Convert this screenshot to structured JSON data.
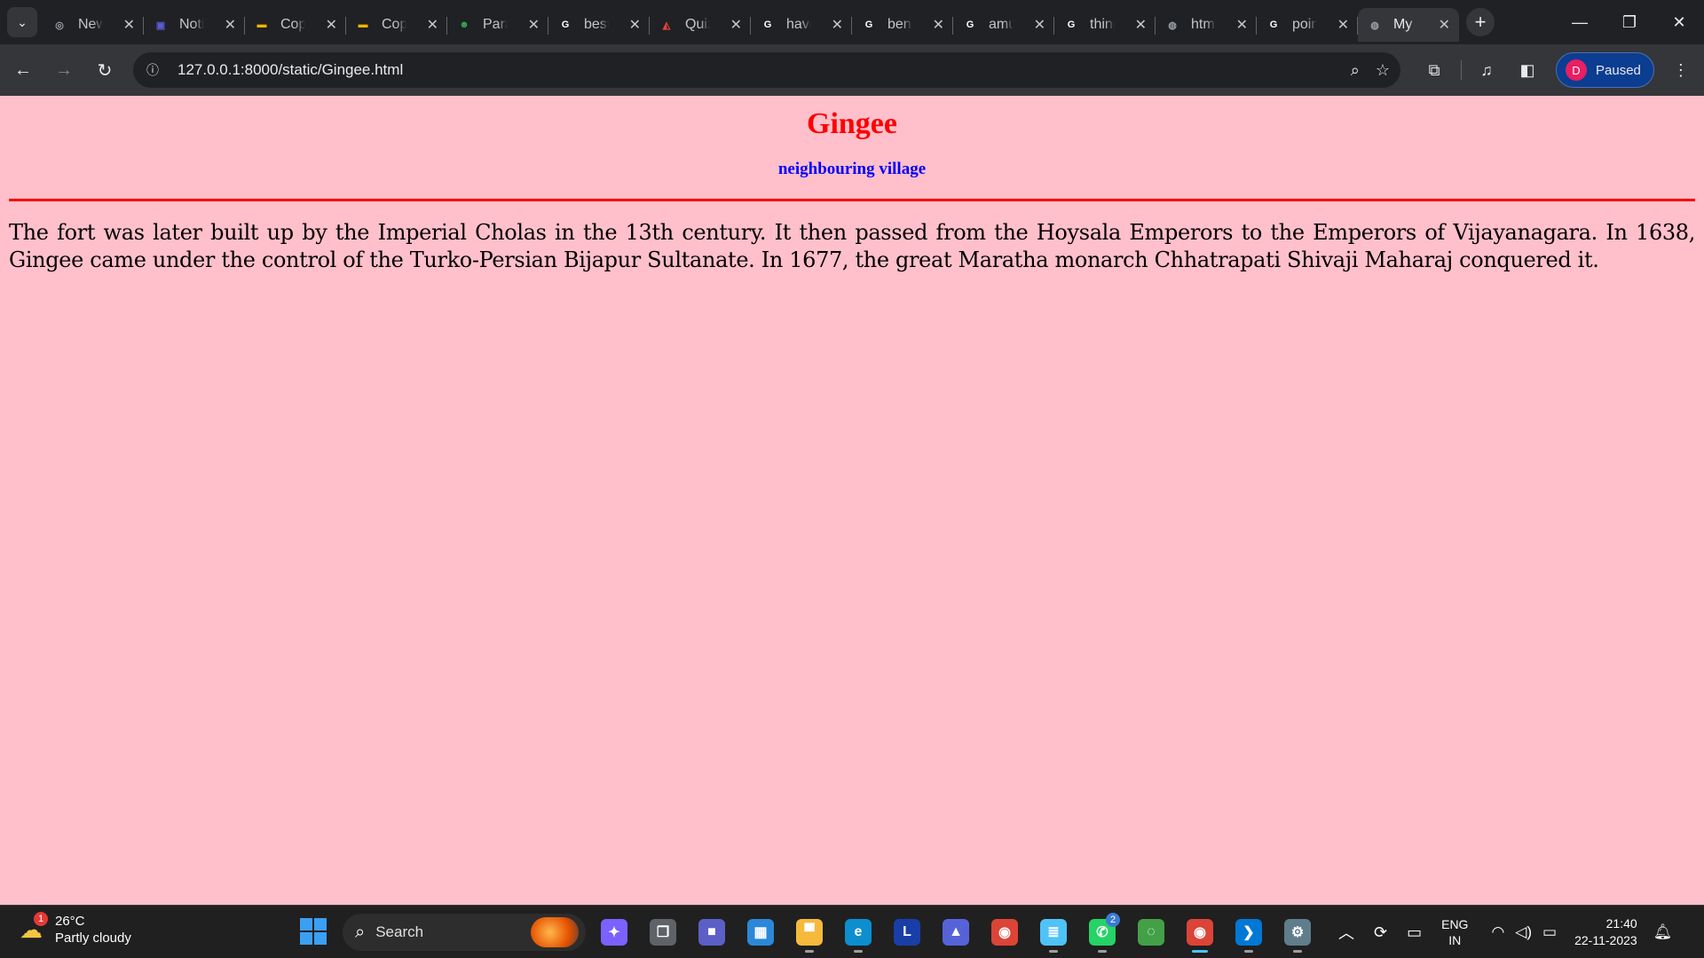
{
  "browser": {
    "tabs": [
      {
        "title": "New Tab",
        "favicon": "chrome-icon",
        "color": "#9aa0a6",
        "glyph": "◎"
      },
      {
        "title": "Notion",
        "favicon": "notion-icon",
        "color": "#5b5bd6",
        "glyph": "▣"
      },
      {
        "title": "Copy of Slides",
        "favicon": "slides-icon",
        "color": "#f4b400",
        "glyph": "▬"
      },
      {
        "title": "Copy of Slides",
        "favicon": "slides-icon",
        "color": "#f4b400",
        "glyph": "▬"
      },
      {
        "title": "Paraphraser",
        "favicon": "robot-icon",
        "color": "#34a853",
        "glyph": "☻"
      },
      {
        "title": "best",
        "favicon": "google-icon",
        "color": "#ffffff",
        "glyph": "G"
      },
      {
        "title": "Quiz",
        "favicon": "quiz-icon",
        "color": "#ea4335",
        "glyph": "◭"
      },
      {
        "title": "have",
        "favicon": "google-icon",
        "color": "#ffffff",
        "glyph": "G"
      },
      {
        "title": "benefits",
        "favicon": "google-icon",
        "color": "#ffffff",
        "glyph": "G"
      },
      {
        "title": "amu",
        "favicon": "google-icon",
        "color": "#ffffff",
        "glyph": "G"
      },
      {
        "title": "things",
        "favicon": "google-icon",
        "color": "#ffffff",
        "glyph": "G"
      },
      {
        "title": "html",
        "favicon": "globe-icon",
        "color": "#9aa0a6",
        "glyph": "◍"
      },
      {
        "title": "points",
        "favicon": "google-icon",
        "color": "#ffffff",
        "glyph": "G"
      },
      {
        "title": "My",
        "favicon": "globe-icon",
        "color": "#9aa0a6",
        "glyph": "◍",
        "active": true
      }
    ],
    "url": "127.0.0.1:8000/static/Gingee.html",
    "profile": {
      "initial": "D",
      "status": "Paused"
    }
  },
  "page": {
    "heading": "Gingee",
    "subheading": "neighbouring village",
    "paragraph": "The fort was later built up by the Imperial Cholas in the 13th century. It then passed from the Hoysala Emperors to the Emperors of Vijayanagara. In 1638, Gingee came under the control of the Turko-Persian Bijapur Sultanate. In 1677, the great Maratha monarch Chhatrapati Shivaji Maharaj conquered it.",
    "background": "#ffc0cb",
    "heading_color": "#ff0000",
    "subheading_color": "#0000ff"
  },
  "taskbar": {
    "weather": {
      "temp": "26°C",
      "condition": "Partly cloudy",
      "badge": "1"
    },
    "search_placeholder": "Search",
    "apps": [
      {
        "name": "copilot-icon",
        "color": "#7b61ff",
        "glyph": "✦"
      },
      {
        "name": "task-view-icon",
        "color": "#5f6368",
        "glyph": "❐"
      },
      {
        "name": "teams-icon",
        "color": "#5b5fc7",
        "glyph": "■"
      },
      {
        "name": "store-icon",
        "color": "#2b88d8",
        "glyph": "▦"
      },
      {
        "name": "file-explorer-icon",
        "color": "#f6b93b",
        "glyph": "▀",
        "running": true
      },
      {
        "name": "edge-icon",
        "color": "#0c8ecf",
        "glyph": "e",
        "running": true
      },
      {
        "name": "lightshot-icon",
        "color": "#1a3ea8",
        "glyph": "L"
      },
      {
        "name": "app-icon",
        "color": "#5663d8",
        "glyph": "▲"
      },
      {
        "name": "chrome-icon",
        "color": "#db4437",
        "glyph": "◉"
      },
      {
        "name": "notepad-icon",
        "color": "#4fc3f7",
        "glyph": "≣",
        "running": true
      },
      {
        "name": "whatsapp-icon",
        "color": "#25d366",
        "glyph": "✆",
        "badge": "2",
        "running": true
      },
      {
        "name": "loader-icon",
        "color": "#43a047",
        "glyph": "◌"
      },
      {
        "name": "chrome-profile-icon",
        "color": "#db4437",
        "glyph": "◉",
        "active": true
      },
      {
        "name": "vscode-icon",
        "color": "#0078d4",
        "glyph": "❯",
        "running": true
      },
      {
        "name": "settings-icon",
        "color": "#607d8b",
        "glyph": "⚙",
        "running": true
      }
    ],
    "language": [
      "ENG",
      "IN"
    ],
    "time": "21:40",
    "date": "22-11-2023"
  }
}
